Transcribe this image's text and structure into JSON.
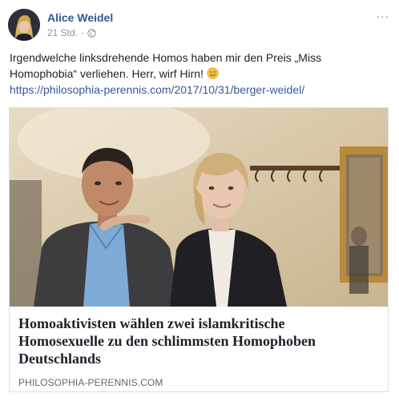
{
  "post": {
    "author": "Alice Weidel",
    "timestamp": "21 Std.",
    "separator": "·",
    "privacy_icon": "globe-icon",
    "more_icon": "...",
    "text": "Irgendwelche linksdrehende Homos haben mir den Preis „Miss Homophobia“ verliehen. Herr, wirf Hirn!",
    "emoji": "smiley-icon",
    "link": "https://philosophia-perennis.com/2017/10/31/berger-weidel/"
  },
  "card": {
    "image": "photo-of-two-people",
    "title": "Homoaktivisten wählen zwei islamkritische Homosexuelle zu den schlimmsten Homophoben Deutschlands",
    "domain": "PHILOSOPHIA-PERENNIS.COM"
  },
  "colors": {
    "link": "#365899",
    "text": "#1d2129",
    "meta": "#90949c",
    "border": "#dddfe2"
  }
}
